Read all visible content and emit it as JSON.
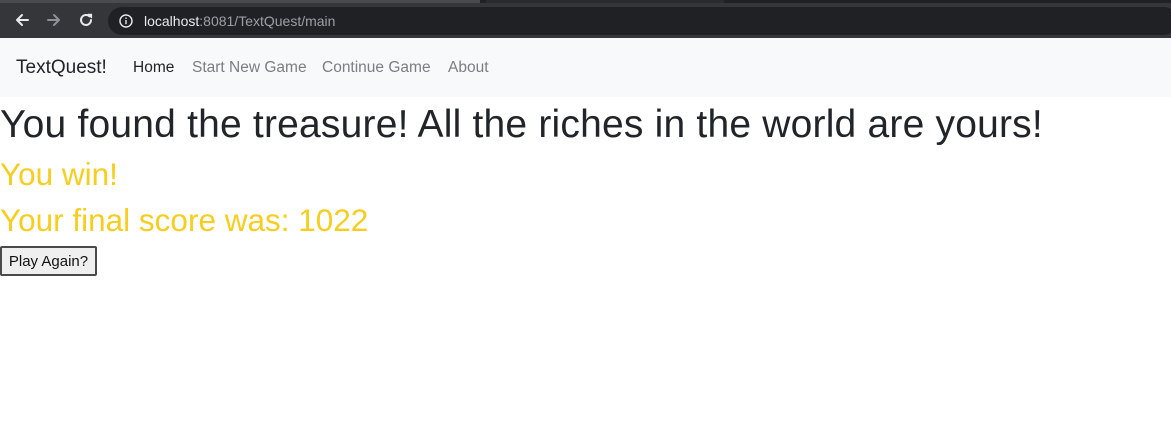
{
  "browser": {
    "url_host": "localhost",
    "url_path": ":8081/TextQuest/main",
    "icons": {
      "back": "arrow-left-icon",
      "forward": "arrow-right-icon",
      "reload": "reload-icon",
      "site_info": "info-icon"
    }
  },
  "navbar": {
    "brand": "TextQuest!",
    "links": [
      {
        "label": "Home",
        "active": true
      },
      {
        "label": "Start New Game",
        "active": false
      },
      {
        "label": "Continue Game",
        "active": false
      },
      {
        "label": "About",
        "active": false
      }
    ]
  },
  "main": {
    "heading": "You found the treasure! All the riches in the world are yours!",
    "win_message": "You win!",
    "score_message": "Your final score was: 1022",
    "play_again_label": "Play Again?"
  },
  "colors": {
    "accent_gold": "#f7cd1f",
    "text_dark": "#212529",
    "nav_muted": "#7a7e82",
    "navbar_bg": "#f8f9fa",
    "browser_toolbar": "#35363a"
  }
}
